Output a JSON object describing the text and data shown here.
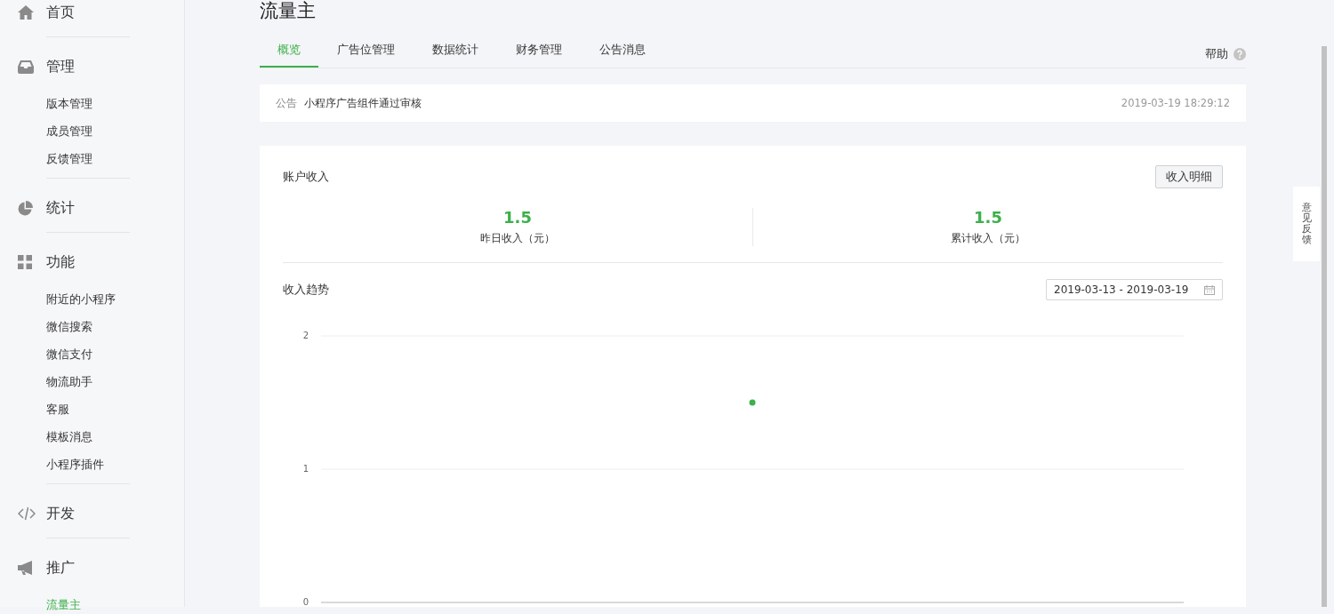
{
  "sidebar": {
    "groups": [
      {
        "label": "首页"
      },
      {
        "label": "管理",
        "children": [
          {
            "label": "版本管理",
            "selected": false
          },
          {
            "label": "成员管理",
            "selected": false
          },
          {
            "label": "反馈管理",
            "selected": false
          }
        ]
      },
      {
        "label": "统计"
      },
      {
        "label": "功能",
        "children": [
          {
            "label": "附近的小程序",
            "selected": false
          },
          {
            "label": "微信搜索",
            "selected": false
          },
          {
            "label": "微信支付",
            "selected": false
          },
          {
            "label": "物流助手",
            "selected": false
          },
          {
            "label": "客服",
            "selected": false
          },
          {
            "label": "模板消息",
            "selected": false
          },
          {
            "label": "小程序插件",
            "selected": false
          }
        ]
      },
      {
        "label": "开发"
      },
      {
        "label": "推广",
        "children": [
          {
            "label": "流量主",
            "selected": true
          }
        ]
      }
    ]
  },
  "page_title": "流量主",
  "tabs": [
    {
      "label": "概览",
      "selected": true
    },
    {
      "label": "广告位管理",
      "selected": false
    },
    {
      "label": "数据统计",
      "selected": false
    },
    {
      "label": "财务管理",
      "selected": false
    },
    {
      "label": "公告消息",
      "selected": false
    }
  ],
  "help": "帮助",
  "notice": {
    "tag": "公告",
    "text": "小程序广告组件通过审核",
    "time": "2019-03-19 18:29:12"
  },
  "income": {
    "title": "账户收入",
    "detail_button": "收入明细",
    "stats": [
      {
        "value": "1.5",
        "label": "昨日收入（元）"
      },
      {
        "value": "1.5",
        "label": "累计收入（元）"
      }
    ]
  },
  "trend": {
    "title": "收入趋势",
    "date_range": "2019-03-13 - 2019-03-19",
    "chart_data": {
      "type": "line",
      "ylim": [
        0,
        2
      ],
      "yticks": [
        0,
        1,
        2
      ],
      "series": [
        {
          "color": "#3cb04a",
          "marker": true,
          "values": [
            1.5
          ]
        }
      ]
    }
  },
  "feedback": "意见反馈"
}
